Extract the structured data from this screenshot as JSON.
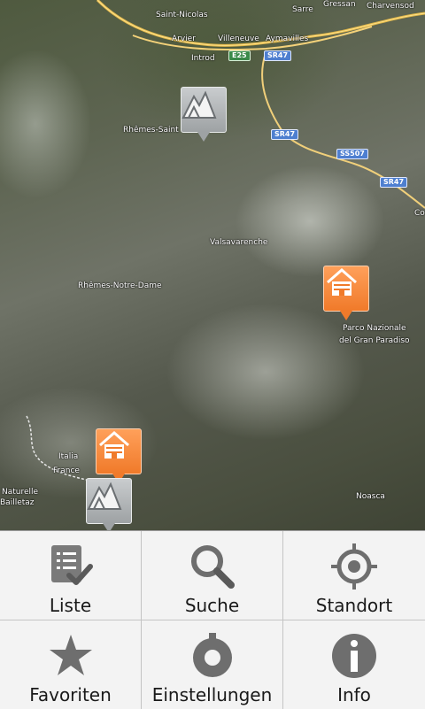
{
  "map": {
    "places": [
      {
        "text": "Saint-Nicolas"
      },
      {
        "text": "Sarre"
      },
      {
        "text": "Gressan"
      },
      {
        "text": "Charvensod"
      },
      {
        "text": "Arvier"
      },
      {
        "text": "Villeneuve"
      },
      {
        "text": "Aymavilles"
      },
      {
        "text": "Introd"
      },
      {
        "text": "Rhêmes-Saint"
      },
      {
        "text": "Valsavarenche"
      },
      {
        "text": "Rhêmes-Notre-Dame"
      },
      {
        "text": "Parco Nazionale"
      },
      {
        "text": "del Gran Paradiso"
      },
      {
        "text": "Italia"
      },
      {
        "text": "France"
      },
      {
        "text": "Naturelle"
      },
      {
        "text": "Bailletaz"
      },
      {
        "text": "Noasca"
      },
      {
        "text": "Co"
      }
    ],
    "roads": [
      "E25",
      "SR47",
      "SR47",
      "SS507",
      "SR47"
    ],
    "markers": [
      {
        "kind": "mountain-hut",
        "color": "gray"
      },
      {
        "kind": "lodge",
        "color": "orange"
      },
      {
        "kind": "lodge",
        "color": "orange"
      },
      {
        "kind": "mountain-hut",
        "color": "gray"
      }
    ]
  },
  "menu": {
    "items": [
      {
        "label": "Liste",
        "icon": "list-icon"
      },
      {
        "label": "Suche",
        "icon": "search-icon"
      },
      {
        "label": "Standort",
        "icon": "location-icon"
      },
      {
        "label": "Favoriten",
        "icon": "star-icon"
      },
      {
        "label": "Einstellungen",
        "icon": "gear-icon"
      },
      {
        "label": "Info",
        "icon": "info-icon"
      }
    ]
  }
}
